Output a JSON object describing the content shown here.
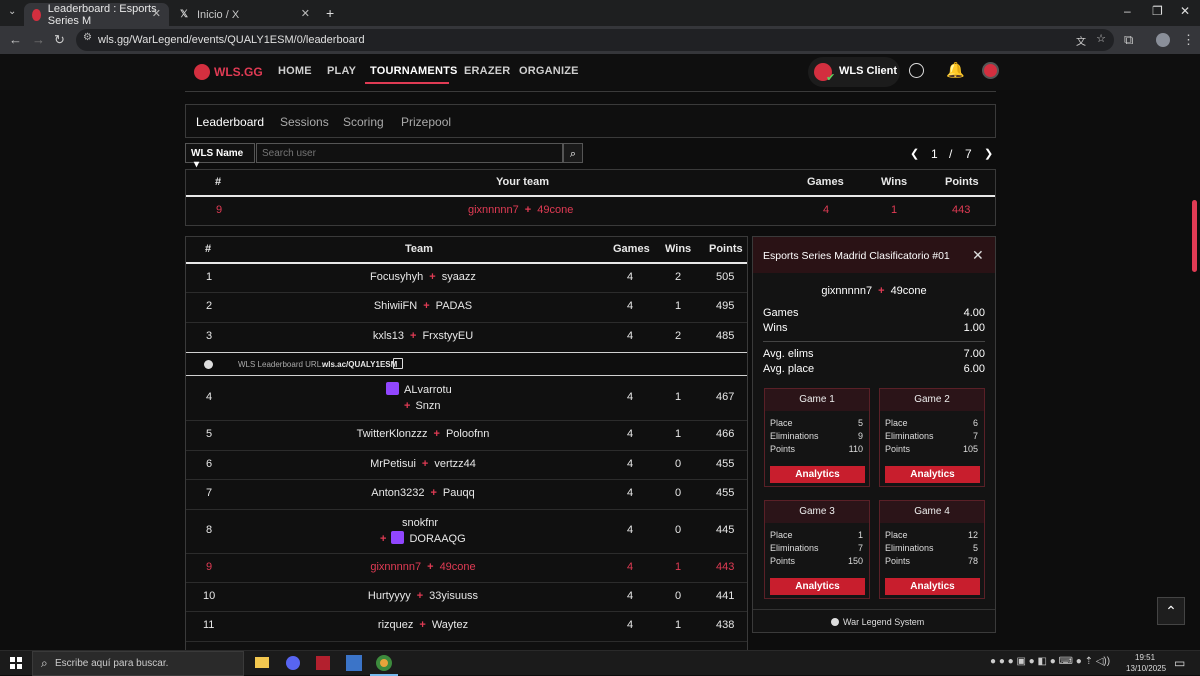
{
  "browser": {
    "tabs": [
      {
        "label": "Leaderboard : Esports Series M",
        "close": "✕"
      },
      {
        "label": "Inicio / X",
        "close": "✕"
      }
    ],
    "new_tab": "+",
    "url": "wls.gg/WarLegend/events/QUALY1ESM/0/leaderboard"
  },
  "site": {
    "logo": "WLS.GG",
    "nav": [
      "HOME",
      "PLAY",
      "TOURNAMENTS",
      "ERAZER",
      "ORGANIZE"
    ],
    "client_label": "WLS Client",
    "accent": "#e03b54"
  },
  "subtabs": [
    "Leaderboard",
    "Sessions",
    "Scoring",
    "Prizepool"
  ],
  "filter": {
    "select": "WLS Name",
    "placeholder": "Search user"
  },
  "pager": {
    "current": "1",
    "sep": "/",
    "total": "7"
  },
  "your_team": {
    "headers": {
      "rank": "#",
      "team": "Your team",
      "games": "Games",
      "wins": "Wins",
      "points": "Points"
    },
    "row": {
      "rank": "9",
      "p1": "gixnnnnn7",
      "p2": "49cone",
      "games": "4",
      "wins": "1",
      "points": "443"
    }
  },
  "leaderboard": {
    "headers": {
      "rank": "#",
      "team": "Team",
      "games": "Games",
      "wins": "Wins",
      "points": "Points"
    },
    "url_text": "WLS Leaderboard URL:",
    "url_value": "wls.ac/QUALY1ESM",
    "rows": [
      {
        "rank": "1",
        "p1": "Focusyhyh",
        "p2": "syaazz",
        "games": "4",
        "wins": "2",
        "points": "505"
      },
      {
        "rank": "2",
        "p1": "ShiwiiFN",
        "p2": "PADAS",
        "games": "4",
        "wins": "1",
        "points": "495"
      },
      {
        "rank": "3",
        "p1": "kxls13",
        "p2": "FrxstyyEU",
        "games": "4",
        "wins": "2",
        "points": "485"
      },
      {
        "rank": "4",
        "p1": "ALvarrotu",
        "p2": "Snzn",
        "games": "4",
        "wins": "1",
        "points": "467"
      },
      {
        "rank": "5",
        "p1": "TwitterKlonzzz",
        "p2": "Poloofnn",
        "games": "4",
        "wins": "1",
        "points": "466"
      },
      {
        "rank": "6",
        "p1": "MrPetisui",
        "p2": "vertzz44",
        "games": "4",
        "wins": "0",
        "points": "455"
      },
      {
        "rank": "7",
        "p1": "Anton3232",
        "p2": "Pauqq",
        "games": "4",
        "wins": "0",
        "points": "455"
      },
      {
        "rank": "8",
        "p1": "snokfnr",
        "p2": "DORAAQG",
        "games": "4",
        "wins": "0",
        "points": "445"
      },
      {
        "rank": "9",
        "p1": "gixnnnnn7",
        "p2": "49cone",
        "games": "4",
        "wins": "1",
        "points": "443"
      },
      {
        "rank": "10",
        "p1": "Hurtyyyy",
        "p2": "33yisuuss",
        "games": "4",
        "wins": "0",
        "points": "441"
      },
      {
        "rank": "11",
        "p1": "rizquez",
        "p2": "Waytez",
        "games": "4",
        "wins": "1",
        "points": "438"
      }
    ]
  },
  "panel": {
    "title": "Esports Series Madrid Clasificatorio #01",
    "p1": "gixnnnnn7",
    "p2": "49cone",
    "games_label": "Games",
    "games": "4.00",
    "wins_label": "Wins",
    "wins": "1.00",
    "elims_label": "Avg. elims",
    "elims": "7.00",
    "place_label": "Avg. place",
    "place": "6.00",
    "place_l": "Place",
    "elim_l": "Eliminations",
    "points_l": "Points",
    "analytics": "Analytics",
    "footer": "War Legend System",
    "games_list": [
      {
        "title": "Game 1",
        "place": "5",
        "elims": "9",
        "points": "110"
      },
      {
        "title": "Game 2",
        "place": "6",
        "elims": "7",
        "points": "105"
      },
      {
        "title": "Game 3",
        "place": "1",
        "elims": "7",
        "points": "150"
      },
      {
        "title": "Game 4",
        "place": "12",
        "elims": "5",
        "points": "78"
      }
    ]
  },
  "taskbar": {
    "search": "Escribe aquí para buscar.",
    "time": "19:51",
    "date": "13/10/2025"
  }
}
